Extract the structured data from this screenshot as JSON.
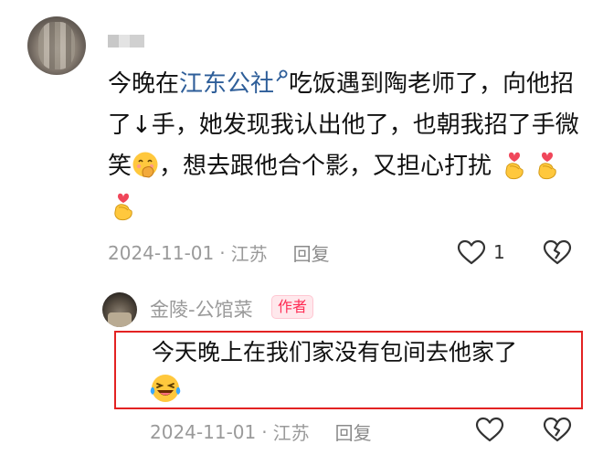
{
  "main_comment": {
    "text_before": "今晚在",
    "link": "江东公社",
    "text_after_link": "吃饭遇到陶老师了，向他招了↓手，她发现我认出他了，也朝我招了手微笑",
    "text_after_emoji": "，想去跟他合个影，又担心打扰",
    "date": "2024-11-01",
    "dot": "·",
    "location": "江苏",
    "reply_label": "回复",
    "like_count": "1"
  },
  "reply": {
    "author": "金陵-公馆菜",
    "badge": "作者",
    "text": "今天晚上在我们家没有包间去他家了",
    "date": "2024-11-01",
    "dot": "·",
    "location": "江苏",
    "reply_label": "回复"
  },
  "colors": {
    "link": "#2e5e99",
    "badge_text": "#ff2d55",
    "highlight_box": "#e32222"
  },
  "icons": [
    "heart-icon",
    "broken-heart-icon",
    "link-search-icon",
    "smile-covering-mouth-emoji",
    "finger-heart-emoji",
    "laughing-tears-emoji"
  ]
}
